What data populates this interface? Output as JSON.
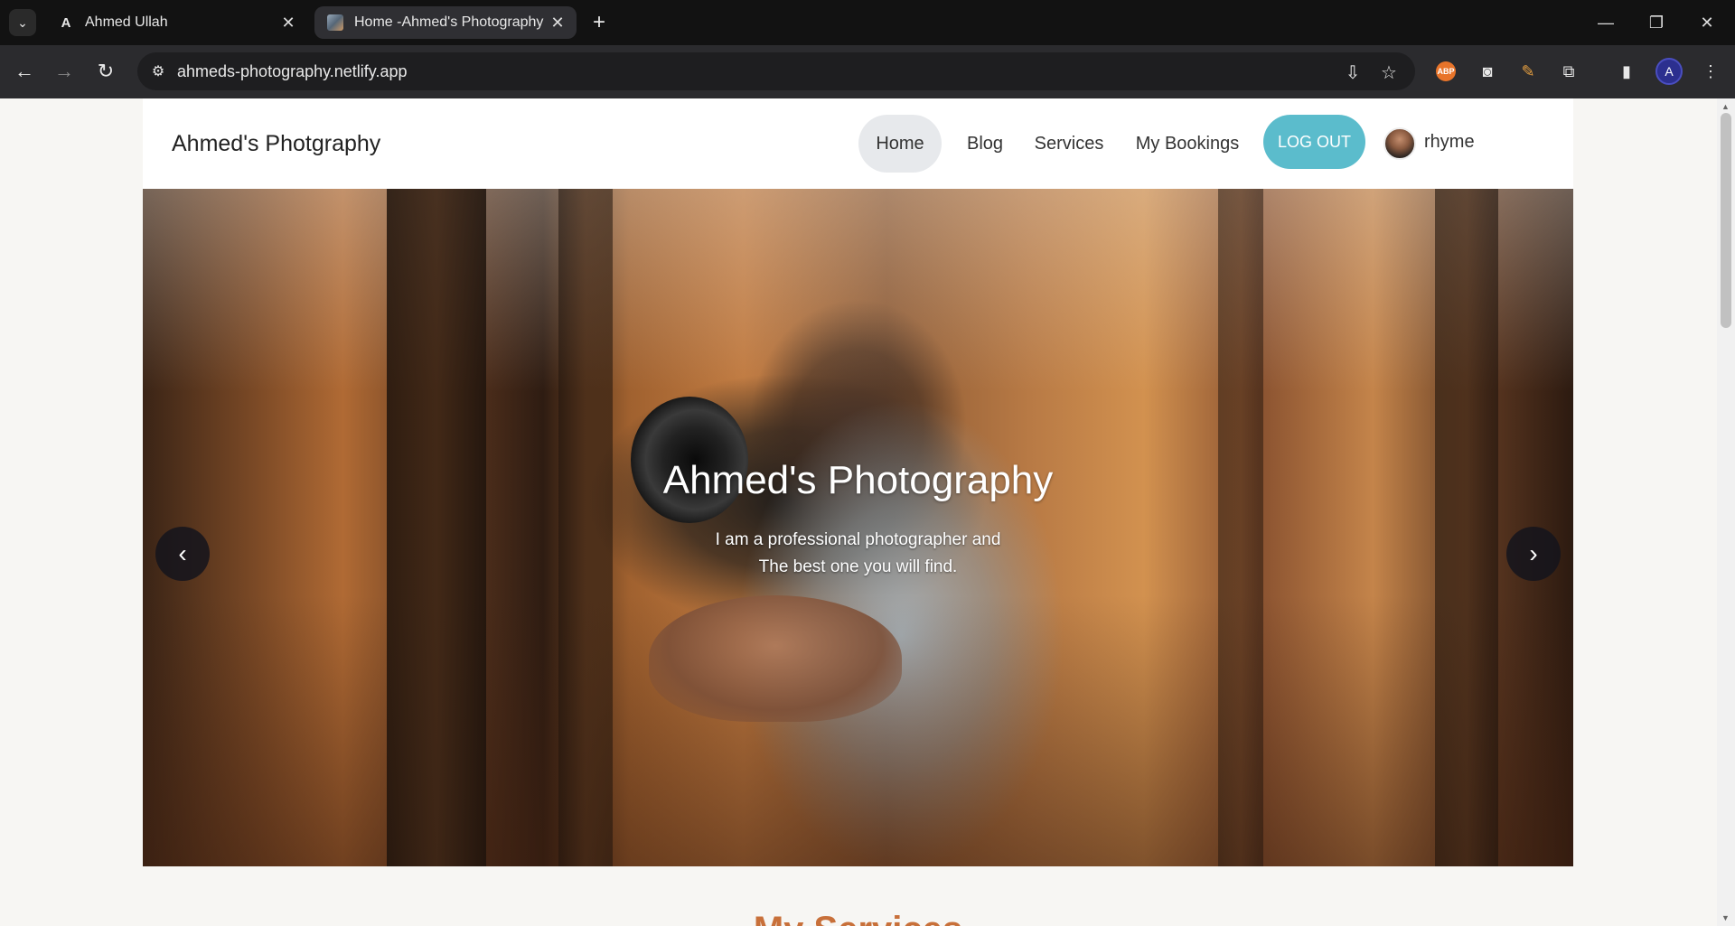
{
  "browser": {
    "tabs": [
      {
        "title": "Ahmed Ullah",
        "favicon": "A",
        "active": false
      },
      {
        "title": "Home -Ahmed's Photography",
        "active": true
      }
    ],
    "url": "ahmeds-photography.netlify.app",
    "profile_initial": "A",
    "abp_label": "ABP"
  },
  "site": {
    "brand": "Ahmed's Photgraphy",
    "nav": [
      {
        "label": "Home",
        "active": true
      },
      {
        "label": "Blog",
        "active": false
      },
      {
        "label": "Services",
        "active": false
      },
      {
        "label": "My Bookings",
        "active": false
      }
    ],
    "logout_label": "LOG OUT",
    "username": "rhyme",
    "accent_color": "#5bbccc"
  },
  "hero": {
    "title": "Ahmed's Photography",
    "subtitle_line1": "I am a professional photographer and",
    "subtitle_line2": "The best one you will find.",
    "prev_label": "‹",
    "next_label": "›"
  },
  "next_section": {
    "heading_peek": "My Services"
  }
}
